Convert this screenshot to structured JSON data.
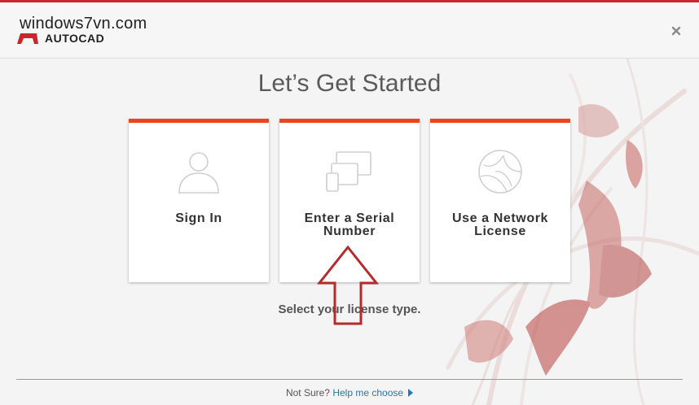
{
  "header": {
    "watermark": "windows7vn.com",
    "product": "AUTOCAD"
  },
  "page": {
    "title": "Let’s Get Started",
    "prompt": "Select your license type."
  },
  "cards": [
    {
      "line1": "Sign In",
      "line2": "",
      "icon": "user-silhouette-icon"
    },
    {
      "line1": "Enter a Serial",
      "line2": "Number",
      "icon": "devices-icon"
    },
    {
      "line1": "Use a Network",
      "line2": "License",
      "icon": "globe-icon"
    }
  ],
  "footer": {
    "question": "Not Sure?",
    "help_link": "Help me choose"
  },
  "colors": {
    "accent": "#e8461e",
    "brand": "#c9272d",
    "link": "#1a7bbf",
    "annotation_arrow": "#b52a2a"
  }
}
